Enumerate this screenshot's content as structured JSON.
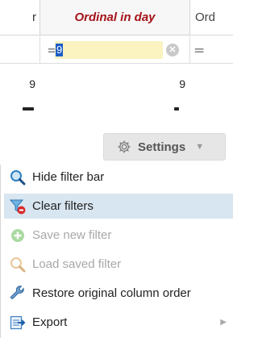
{
  "grid": {
    "columns": [
      {
        "label": "r",
        "filter_op": "",
        "filter_value": ""
      },
      {
        "label": "Ordinal in day",
        "filter_op": "=",
        "filter_value": "9"
      },
      {
        "label": "Ord",
        "filter_op": "=",
        "filter_value": ""
      }
    ],
    "rows": [
      {
        "cells": [
          "9",
          "9",
          ""
        ]
      }
    ]
  },
  "settings_button": {
    "label": "Settings"
  },
  "menu": {
    "items": [
      {
        "label": "Hide filter bar",
        "icon": "magnifier-icon",
        "enabled": true
      },
      {
        "label": "Clear filters",
        "icon": "clear-filter-icon",
        "enabled": true,
        "highlighted": true
      },
      {
        "label": "Save new filter",
        "icon": "add-circle-icon",
        "enabled": false
      },
      {
        "label": "Load saved filter",
        "icon": "magnifier-icon",
        "enabled": false
      },
      {
        "label": "Restore original column order",
        "icon": "wrench-icon",
        "enabled": true
      },
      {
        "label": "Export",
        "icon": "export-icon",
        "enabled": true,
        "has_submenu": true
      }
    ]
  },
  "colors": {
    "header_accent": "#a4131a",
    "filter_highlight": "#fbf3c0",
    "selection": "#1e5dc8",
    "menu_hover": "#d8e6f1"
  }
}
